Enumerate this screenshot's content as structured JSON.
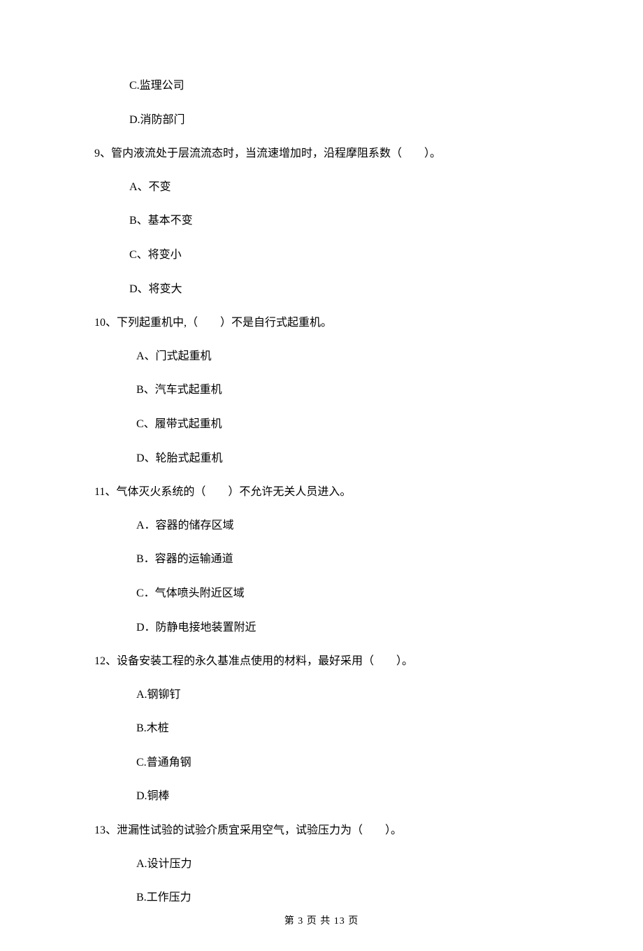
{
  "options_pre": [
    "C.监理公司",
    "D.消防部门"
  ],
  "questions": [
    {
      "num": "9",
      "text": "、管内液流处于层流流态时，当流速增加时，沿程摩阻系数（　　）。",
      "options": [
        "A、不变",
        "B、基本不变",
        "C、将变小",
        "D、将变大"
      ]
    },
    {
      "num": "10",
      "text": "、下列起重机中,（　　）不是自行式起重机。",
      "options": [
        "A、门式起重机",
        "B、汽车式起重机",
        "C、履带式起重机",
        "D、轮胎式起重机"
      ]
    },
    {
      "num": "11",
      "text": "、气体灭火系统的（　　）不允许无关人员进入。",
      "options": [
        "A．容器的储存区域",
        "B．容器的运输通道",
        "C．气体喷头附近区域",
        "D．防静电接地装置附近"
      ]
    },
    {
      "num": "12",
      "text": "、设备安装工程的永久基准点使用的材料，最好采用（　　）。",
      "options": [
        "A.钢铆钉",
        "B.木桩",
        "C.普通角钢",
        "D.铜棒"
      ]
    },
    {
      "num": "13",
      "text": "、泄漏性试验的试验介质宜采用空气，试验压力为（　　）。",
      "options": [
        "A.设计压力",
        "B.工作压力"
      ]
    }
  ],
  "footer": "第 3 页 共 13 页"
}
